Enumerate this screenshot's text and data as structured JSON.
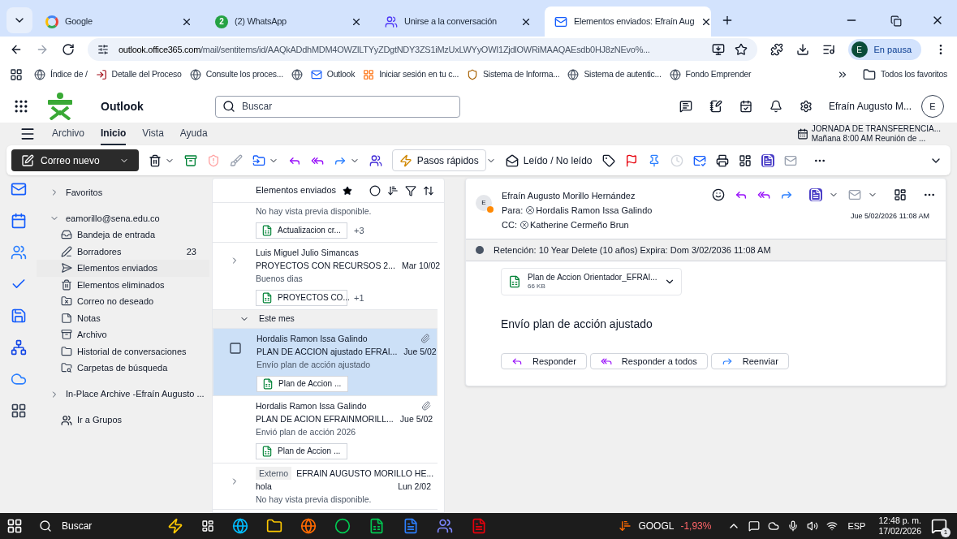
{
  "browser": {
    "tabs": [
      {
        "title": "Google",
        "selected": false,
        "kind": "google"
      },
      {
        "title": "(2) WhatsApp",
        "selected": false,
        "kind": "whatsapp",
        "badge": "2"
      },
      {
        "title": "Unirse a la conversación",
        "selected": false,
        "kind": "teams"
      },
      {
        "title": "Elementos enviados: Efraín Aug",
        "selected": true,
        "kind": "outlook"
      }
    ],
    "url_host": "outlook.office365.com",
    "url_path": "/mail/sentitems/id/AAQkADdhMDM4OWZlLTYyZDgtNDY3ZS1iMzUxLWYyOWI1ZjdlOWRiMAAQAEsdb0HJ8zNEvo%...",
    "profile": {
      "initial": "E",
      "label": "En pausa"
    },
    "bookmarks": [
      {
        "label": "Índice de /",
        "kind": "globe"
      },
      {
        "label": "Detalle del Proceso",
        "kind": "login"
      },
      {
        "label": "Consulte los proces...",
        "kind": "globe"
      },
      {
        "kind": "globe"
      },
      {
        "label": "Outlook",
        "kind": "outlook"
      },
      {
        "label": "Iniciar sesión en tu c...",
        "kind": "microsoft"
      },
      {
        "label": "Sistema de Informa...",
        "kind": "shield"
      },
      {
        "label": "Sistema de autentic...",
        "kind": "globe"
      },
      {
        "label": "Fondo Emprender",
        "kind": "globe"
      }
    ],
    "all_bookmarks": "Todos los favoritos"
  },
  "outlook": {
    "app_name": "Outlook",
    "search_placeholder": "Buscar",
    "user_name": "Efraín Augusto M...",
    "user_initial": "E"
  },
  "ribbon_tabs": [
    {
      "label": "Archivo",
      "selected": false
    },
    {
      "label": "Inicio",
      "selected": true
    },
    {
      "label": "Vista",
      "selected": false
    },
    {
      "label": "Ayuda",
      "selected": false
    }
  ],
  "reminder": {
    "title": "JORNADA DE TRANSFERENCIA...",
    "subtitle": "Mañana 8:00 AM Reunión de ..."
  },
  "toolbar": {
    "new_mail": "Correo nuevo",
    "quick_steps": "Pasos rápidos",
    "read_unread": "Leído / No leído"
  },
  "folders": {
    "favorites": {
      "label": "Favoritos",
      "expanded": false
    },
    "account": {
      "label": "eamorillo@sena.edu.co",
      "expanded": true
    },
    "items": [
      {
        "label": "Bandeja de entrada",
        "kind": "inbox",
        "selected": false
      },
      {
        "label": "Borradores",
        "kind": "drafts",
        "count": "23",
        "selected": false
      },
      {
        "label": "Elementos enviados",
        "kind": "sent",
        "selected": true
      },
      {
        "label": "Elementos eliminados",
        "kind": "trash",
        "selected": false
      },
      {
        "label": "Correo no deseado",
        "kind": "junk",
        "selected": false
      },
      {
        "label": "Notas",
        "kind": "notes",
        "selected": false
      },
      {
        "label": "Archivo",
        "kind": "archive",
        "selected": false
      },
      {
        "label": "Historial de conversaciones",
        "kind": "folder",
        "selected": false
      },
      {
        "label": "Carpetas de búsqueda",
        "kind": "search",
        "selected": false
      }
    ],
    "archive": {
      "label": "In-Place Archive -Efraín Augusto ...",
      "expanded": false
    },
    "groups": "Ir a Grupos"
  },
  "message_list": {
    "title": "Elementos enviados",
    "items": [
      {
        "kind": "message",
        "preview": "No hay vista previa disponible.",
        "attachment": "Actualizacion cr...",
        "extra": "+3",
        "selected": false,
        "thread": false
      },
      {
        "kind": "message",
        "sender": "Luis Miguel Julio Simancas",
        "subject": "PROYECTOS CON RECURSOS 2...",
        "date": "Mar 10/02",
        "preview": "Buenos dias",
        "attachment": "PROYECTOS CO...",
        "extra": "+1",
        "selected": false,
        "thread": true,
        "paperclip": false
      },
      {
        "kind": "header",
        "label": "Este mes",
        "expanded": true
      },
      {
        "kind": "message",
        "sender": "Hordalis Ramon Issa Galindo",
        "subject": "PLAN DE ACCION ajustado EFRAI...",
        "date": "Jue 5/02",
        "preview": "Envío plan de acción ajustado",
        "attachment": "Plan de Accion ...",
        "selected": true,
        "thread": false,
        "paperclip": true
      },
      {
        "kind": "message",
        "sender": "Hordalis Ramon Issa Galindo",
        "subject": "PLAN DE ACION EFRAINMORILL...",
        "date": "Jue 5/02",
        "preview": "Envió plan de acción 2026",
        "attachment": "Plan de Accion ...",
        "selected": false,
        "thread": false,
        "paperclip": true
      },
      {
        "kind": "message",
        "tag": "Externo",
        "sender": "EFRAIN AUGUSTO MORILLO HE...",
        "subject": "hola",
        "date": "Lun 2/02",
        "preview": "No hay vista previa disponible.",
        "selected": false,
        "thread": true,
        "paperclip": false
      }
    ]
  },
  "reading": {
    "avatar_initial": "E",
    "sender": "Efraín Augusto Morillo Hernández",
    "to_label": "Para:",
    "to": "Hordalis Ramon Issa Galindo",
    "cc_label": "CC:",
    "cc": "Katherine Cermeño Brun",
    "date": "Jue 5/02/2026 11:08 AM",
    "retention": "Retención: 10 Year Delete (10 años) Expira: Dom 3/02/2036 11:08 AM",
    "attachment": {
      "name": "Plan de Accion Orientador_EFRAI...",
      "size": "66 KB"
    },
    "body": "Envío plan de acción ajustado",
    "actions": [
      {
        "label": "Responder",
        "kind": "reply"
      },
      {
        "label": "Responder a todos",
        "kind": "reply_all"
      },
      {
        "label": "Reenviar",
        "kind": "forward"
      }
    ]
  },
  "taskbar": {
    "search": "Buscar",
    "stock_symbol": "GOOGL",
    "stock_change": "-1,93%",
    "language": "ESP",
    "time": "12:48 p. m.",
    "date": "17/02/2026",
    "notifications": "1"
  }
}
